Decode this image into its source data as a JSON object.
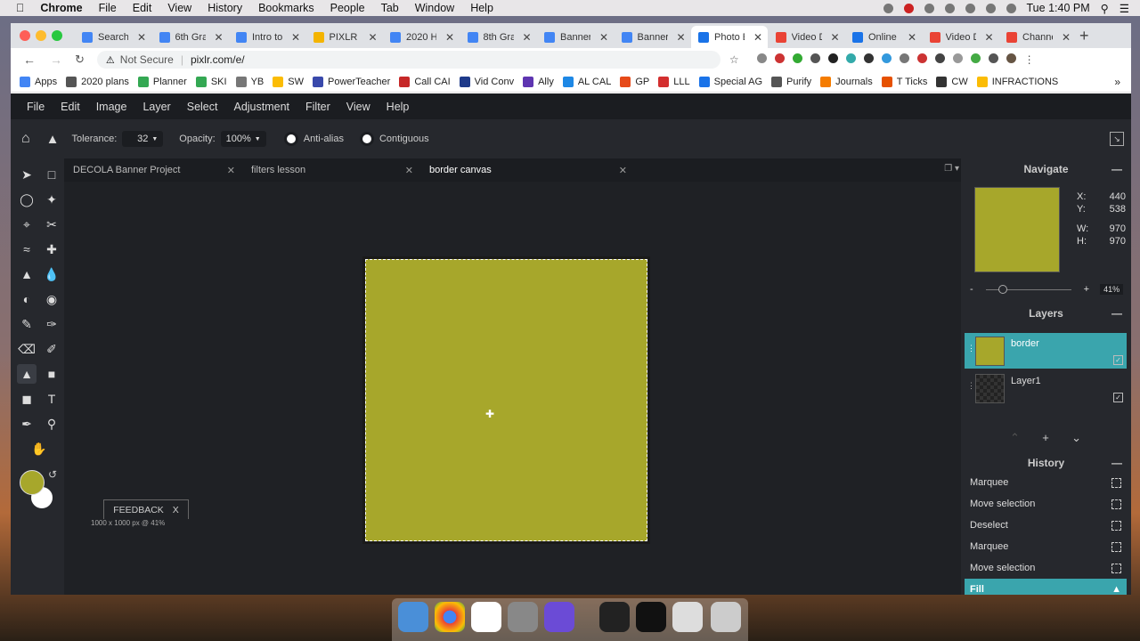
{
  "os_menubar": {
    "items": [
      "Chrome",
      "File",
      "Edit",
      "View",
      "History",
      "Bookmarks",
      "People",
      "Tab",
      "Window",
      "Help"
    ],
    "clock": "Tue 1:40 PM"
  },
  "browser": {
    "tabs": [
      {
        "label": "Search"
      },
      {
        "label": "6th Gra"
      },
      {
        "label": "Intro to"
      },
      {
        "label": "PIXLR L"
      },
      {
        "label": "2020 H"
      },
      {
        "label": "8th Gra"
      },
      {
        "label": "Banner"
      },
      {
        "label": "Banner"
      },
      {
        "label": "Photo E"
      },
      {
        "label": "Video D"
      },
      {
        "label": "Online V"
      },
      {
        "label": "Video D"
      },
      {
        "label": "Channe"
      }
    ],
    "security": "Not Secure",
    "url": "pixlr.com/e/",
    "bookmarks": [
      "Apps",
      "2020 plans",
      "Planner",
      "SKI",
      "YB",
      "SW",
      "PowerTeacher",
      "Call CAI",
      "Vid Conv",
      "Ally",
      "AL CAL",
      "GP",
      "LLL",
      "Special AG",
      "Purify",
      "Journals",
      "T Ticks",
      "CW",
      "INFRACTIONS"
    ]
  },
  "app": {
    "menu": [
      "File",
      "Edit",
      "Image",
      "Layer",
      "Select",
      "Adjustment",
      "Filter",
      "View",
      "Help"
    ],
    "options": {
      "tolerance_label": "Tolerance:",
      "tolerance_value": "32",
      "opacity_label": "Opacity:",
      "opacity_value": "100%",
      "antialias_label": "Anti-alias",
      "contiguous_label": "Contiguous"
    },
    "doc_tabs": [
      "DECOLA Banner Project",
      "filters lesson",
      "border canvas"
    ],
    "feedback": "FEEDBACK",
    "feedback_close": "X",
    "status": "1000 x 1000 px @ 41%",
    "navigate": {
      "title": "Navigate",
      "x_label": "X:",
      "x": "440",
      "y_label": "Y:",
      "y": "538",
      "w_label": "W:",
      "w": "970",
      "h_label": "H:",
      "h": "970",
      "zoom": "41%"
    },
    "layers": {
      "title": "Layers",
      "items": [
        "border",
        "Layer1"
      ]
    },
    "history": {
      "title": "History",
      "items": [
        "Marquee",
        "Move selection",
        "Deselect",
        "Marquee",
        "Move selection",
        "Fill"
      ]
    },
    "colors": {
      "foreground": "#a7a72b",
      "background": "#ffffff",
      "accent": "#3aa5ad"
    }
  }
}
